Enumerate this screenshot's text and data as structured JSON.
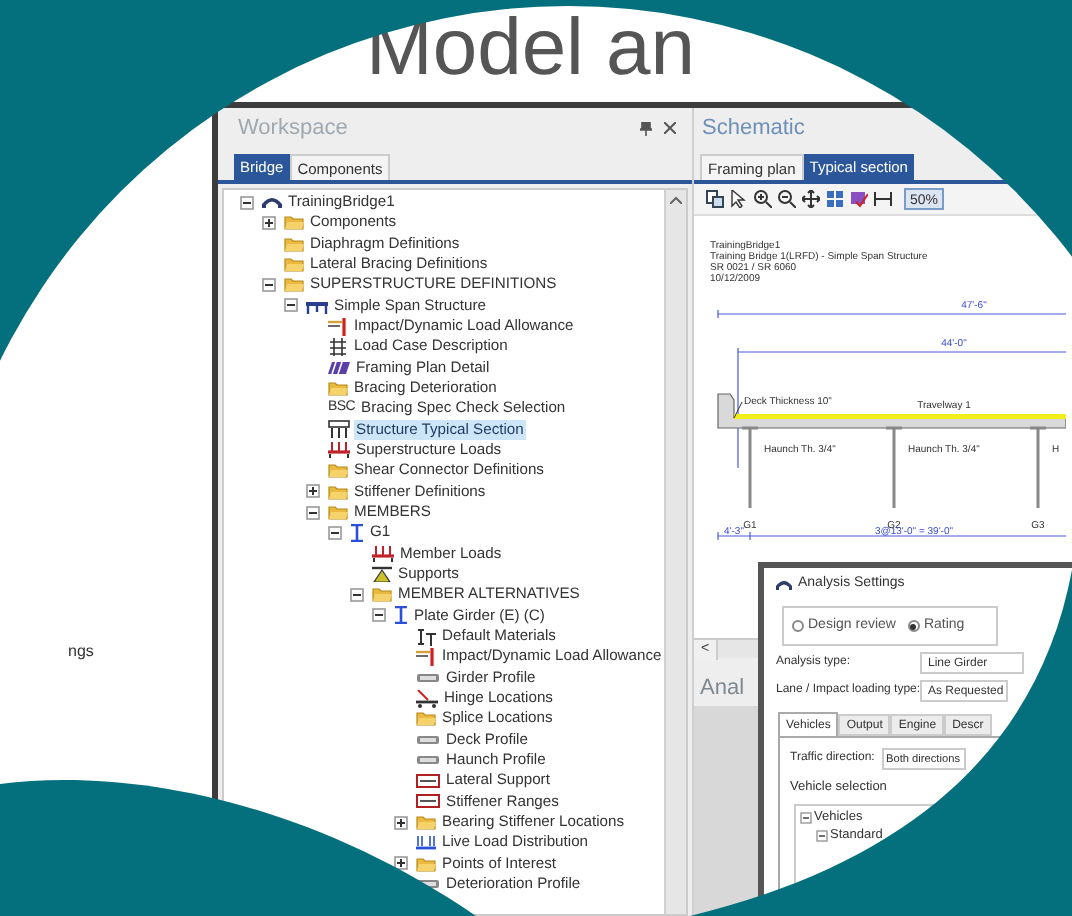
{
  "slide": {
    "title": "Model an",
    "side_text": "ngs"
  },
  "workspace": {
    "title": "Workspace",
    "tabs": [
      {
        "label": "Bridge",
        "selected": true
      },
      {
        "label": "Components",
        "selected": false
      }
    ],
    "tree": [
      {
        "label": "TrainingBridge1",
        "kind": "bridge",
        "expanded": true,
        "selected": false,
        "children": [
          {
            "label": "Components",
            "kind": "folder",
            "expanded": false,
            "selected": false
          },
          {
            "label": "Diaphragm Definitions",
            "kind": "folder",
            "selected": false
          },
          {
            "label": "Lateral Bracing Definitions",
            "kind": "folder",
            "selected": false
          },
          {
            "label": "SUPERSTRUCTURE DEFINITIONS",
            "kind": "folder",
            "expanded": true,
            "selected": false,
            "children": [
              {
                "label": "Simple Span Structure",
                "kind": "structure",
                "expanded": true,
                "selected": false,
                "children": [
                  {
                    "label": "Impact/Dynamic Load Allowance",
                    "kind": "allowance",
                    "selected": false
                  },
                  {
                    "label": "Load Case Description",
                    "kind": "loadcase",
                    "selected": false
                  },
                  {
                    "label": "Framing Plan Detail",
                    "kind": "plan",
                    "selected": false
                  },
                  {
                    "label": "Bracing Deterioration",
                    "kind": "folder",
                    "selected": false
                  },
                  {
                    "label": "Bracing Spec Check Selection",
                    "kind": "text_icon",
                    "icon_text": "BSC",
                    "selected": false
                  },
                  {
                    "label": "Structure Typical Section",
                    "kind": "section",
                    "selected": true
                  },
                  {
                    "label": "Superstructure Loads",
                    "kind": "loads",
                    "selected": false
                  },
                  {
                    "label": "Shear Connector Definitions",
                    "kind": "folder",
                    "selected": false
                  },
                  {
                    "label": "Stiffener Definitions",
                    "kind": "folder",
                    "expanded": false,
                    "selected": false
                  },
                  {
                    "label": "MEMBERS",
                    "kind": "folder",
                    "expanded": true,
                    "selected": false,
                    "children": [
                      {
                        "label": "G1",
                        "kind": "member",
                        "expanded": true,
                        "selected": false,
                        "children": [
                          {
                            "label": "Member Loads",
                            "kind": "loads",
                            "selected": false
                          },
                          {
                            "label": "Supports",
                            "kind": "support",
                            "selected": false
                          },
                          {
                            "label": "MEMBER ALTERNATIVES",
                            "kind": "folder",
                            "expanded": true,
                            "selected": false,
                            "children": [
                              {
                                "label": "Plate Girder (E) (C)",
                                "kind": "member",
                                "expanded": true,
                                "selected": false,
                                "children": [
                                  {
                                    "label": "Default Materials",
                                    "kind": "materials",
                                    "selected": false
                                  },
                                  {
                                    "label": "Impact/Dynamic Load Allowance",
                                    "kind": "allowance",
                                    "selected": false
                                  },
                                  {
                                    "label": "Girder Profile",
                                    "kind": "profile",
                                    "selected": false
                                  },
                                  {
                                    "label": "Hinge Locations",
                                    "kind": "hinge",
                                    "selected": false
                                  },
                                  {
                                    "label": "Splice Locations",
                                    "kind": "folder",
                                    "selected": false
                                  },
                                  {
                                    "label": "Deck Profile",
                                    "kind": "profile",
                                    "selected": false
                                  },
                                  {
                                    "label": "Haunch Profile",
                                    "kind": "profile",
                                    "selected": false
                                  },
                                  {
                                    "label": "Lateral Support",
                                    "kind": "range",
                                    "selected": false
                                  },
                                  {
                                    "label": "Stiffener Ranges",
                                    "kind": "range",
                                    "selected": false
                                  },
                                  {
                                    "label": "Bearing Stiffener Locations",
                                    "kind": "folder",
                                    "expanded": false,
                                    "selected": false
                                  },
                                  {
                                    "label": "Live Load Distribution",
                                    "kind": "distribution",
                                    "selected": false
                                  },
                                  {
                                    "label": "Points of Interest",
                                    "kind": "folder",
                                    "expanded": false,
                                    "selected": false
                                  },
                                  {
                                    "label": "Deterioration Profile",
                                    "kind": "profile",
                                    "selected": false
                                  }
                                ]
                              }
                            ]
                          }
                        ]
                      }
                    ]
                  }
                ]
              }
            ]
          }
        ]
      }
    ]
  },
  "schematic": {
    "title": "Schematic",
    "tabs": [
      {
        "label": "Framing plan",
        "selected": false
      },
      {
        "label": "Typical section",
        "selected": true
      }
    ],
    "zoom": "50%",
    "header_lines": [
      "TrainingBridge1",
      "Training Bridge 1(LRFD) - Simple Span Structure",
      "SR 0021 / SR 6060",
      "10/12/2009"
    ],
    "overall_width": "47'-6\"",
    "roadway_width": "44'-0\"",
    "deck_label": "Deck Thickness 10\"",
    "travelway": "Travelway 1",
    "haunch_labels": [
      "Haunch Th. 3/4\"",
      "Haunch Th. 3/4\"",
      "H"
    ],
    "girder_labels": [
      "G1",
      "G2",
      "G3"
    ],
    "overhang": "4'-3\"",
    "spacing": "3@13'-0\" = 39'-0\"",
    "scroll_left": "<"
  },
  "analysis_panel": {
    "title": "Anal"
  },
  "dialog": {
    "title": "Analysis Settings",
    "modes": [
      {
        "label": "Design review",
        "selected": false
      },
      {
        "label": "Rating",
        "selected": true
      }
    ],
    "fields": [
      {
        "label": "Analysis type:",
        "value": "Line Girder"
      },
      {
        "label": "Lane / Impact loading type:",
        "value": "As Requested"
      }
    ],
    "tabs": [
      {
        "label": "Vehicles",
        "selected": true
      },
      {
        "label": "Output",
        "selected": false
      },
      {
        "label": "Engine",
        "selected": false
      },
      {
        "label": "Descr",
        "selected": false
      }
    ],
    "traffic": {
      "label": "Traffic direction:",
      "value": "Both directions"
    },
    "vehicle_selection": "Vehicle selection",
    "vehicle_tree": [
      {
        "label": "Vehicles",
        "expanded": true,
        "children": [
          {
            "label": "Standard",
            "expanded": true
          }
        ]
      }
    ]
  }
}
